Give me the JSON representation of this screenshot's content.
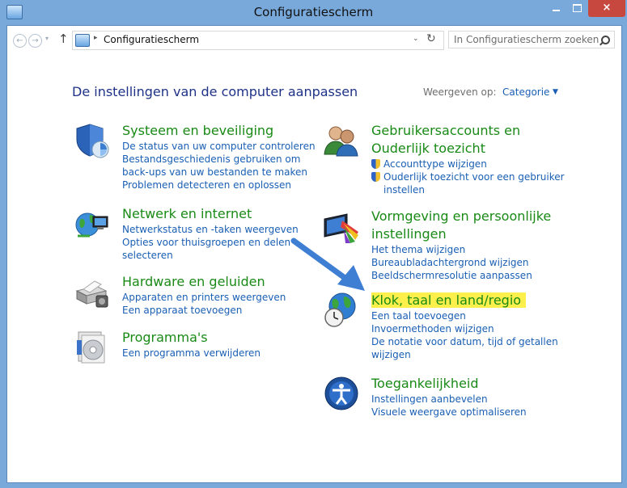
{
  "window": {
    "title": "Configuratiescherm"
  },
  "controls": {
    "minimize": "–",
    "close": "×"
  },
  "nav": {
    "back": "←",
    "forward": "→",
    "up": "↑",
    "address_separator": "▸",
    "address": "Configuratiescherm",
    "dropdown": "⌄",
    "refresh": "↻",
    "search_placeholder": "In Configuratiescherm zoeken"
  },
  "header": {
    "title": "De instellingen van de computer aanpassen",
    "view_label": "Weergeven op:",
    "view_value": "Categorie",
    "view_caret": "▼"
  },
  "categories_left": [
    {
      "title": "Systeem en beveiliging",
      "icon": "shield-icon",
      "links": [
        "De status van uw computer controleren",
        "Bestandsgeschiedenis gebruiken om",
        "back-ups van uw bestanden te maken",
        "Problemen detecteren en oplossen"
      ]
    },
    {
      "title": "Netwerk en internet",
      "icon": "network-icon",
      "links": [
        "Netwerkstatus en -taken weergeven",
        "Opties voor thuisgroepen en delen",
        "selecteren"
      ]
    },
    {
      "title": "Hardware en geluiden",
      "icon": "printer-icon",
      "links": [
        "Apparaten en printers weergeven",
        "Een apparaat toevoegen"
      ]
    },
    {
      "title": "Programma's",
      "icon": "programs-icon",
      "links": [
        "Een programma verwijderen"
      ]
    }
  ],
  "categories_right": [
    {
      "title_line1": "Gebruikersaccounts en",
      "title_line2": "Ouderlijk toezicht",
      "icon": "users-icon",
      "links": [
        "Accounttype wijzigen",
        "Ouderlijk toezicht voor een gebruiker",
        "instellen"
      ]
    },
    {
      "title_line1": "Vormgeving en persoonlijke",
      "title_line2": "instellingen",
      "icon": "appearance-icon",
      "links": [
        "Het thema wijzigen",
        "Bureaubladachtergrond wijzigen",
        "Beeldschermresolutie aanpassen"
      ]
    },
    {
      "title": "Klok, taal en land/regio",
      "icon": "clock-globe-icon",
      "highlight_color": "#fdf04c",
      "links": [
        "Een taal toevoegen",
        "Invoermethoden wijzigen",
        "De notatie voor datum, tijd of getallen",
        "wijzigen"
      ]
    },
    {
      "title": "Toegankelijkheid",
      "icon": "accessibility-icon",
      "links": [
        "Instellingen aanbevelen",
        "Visuele weergave optimaliseren"
      ]
    }
  ],
  "colors": {
    "frame": "#78a9da",
    "category_title": "#198a16",
    "link": "#1a5fb4",
    "page_title": "#1e3287",
    "arrow": "#3f7fd3"
  }
}
